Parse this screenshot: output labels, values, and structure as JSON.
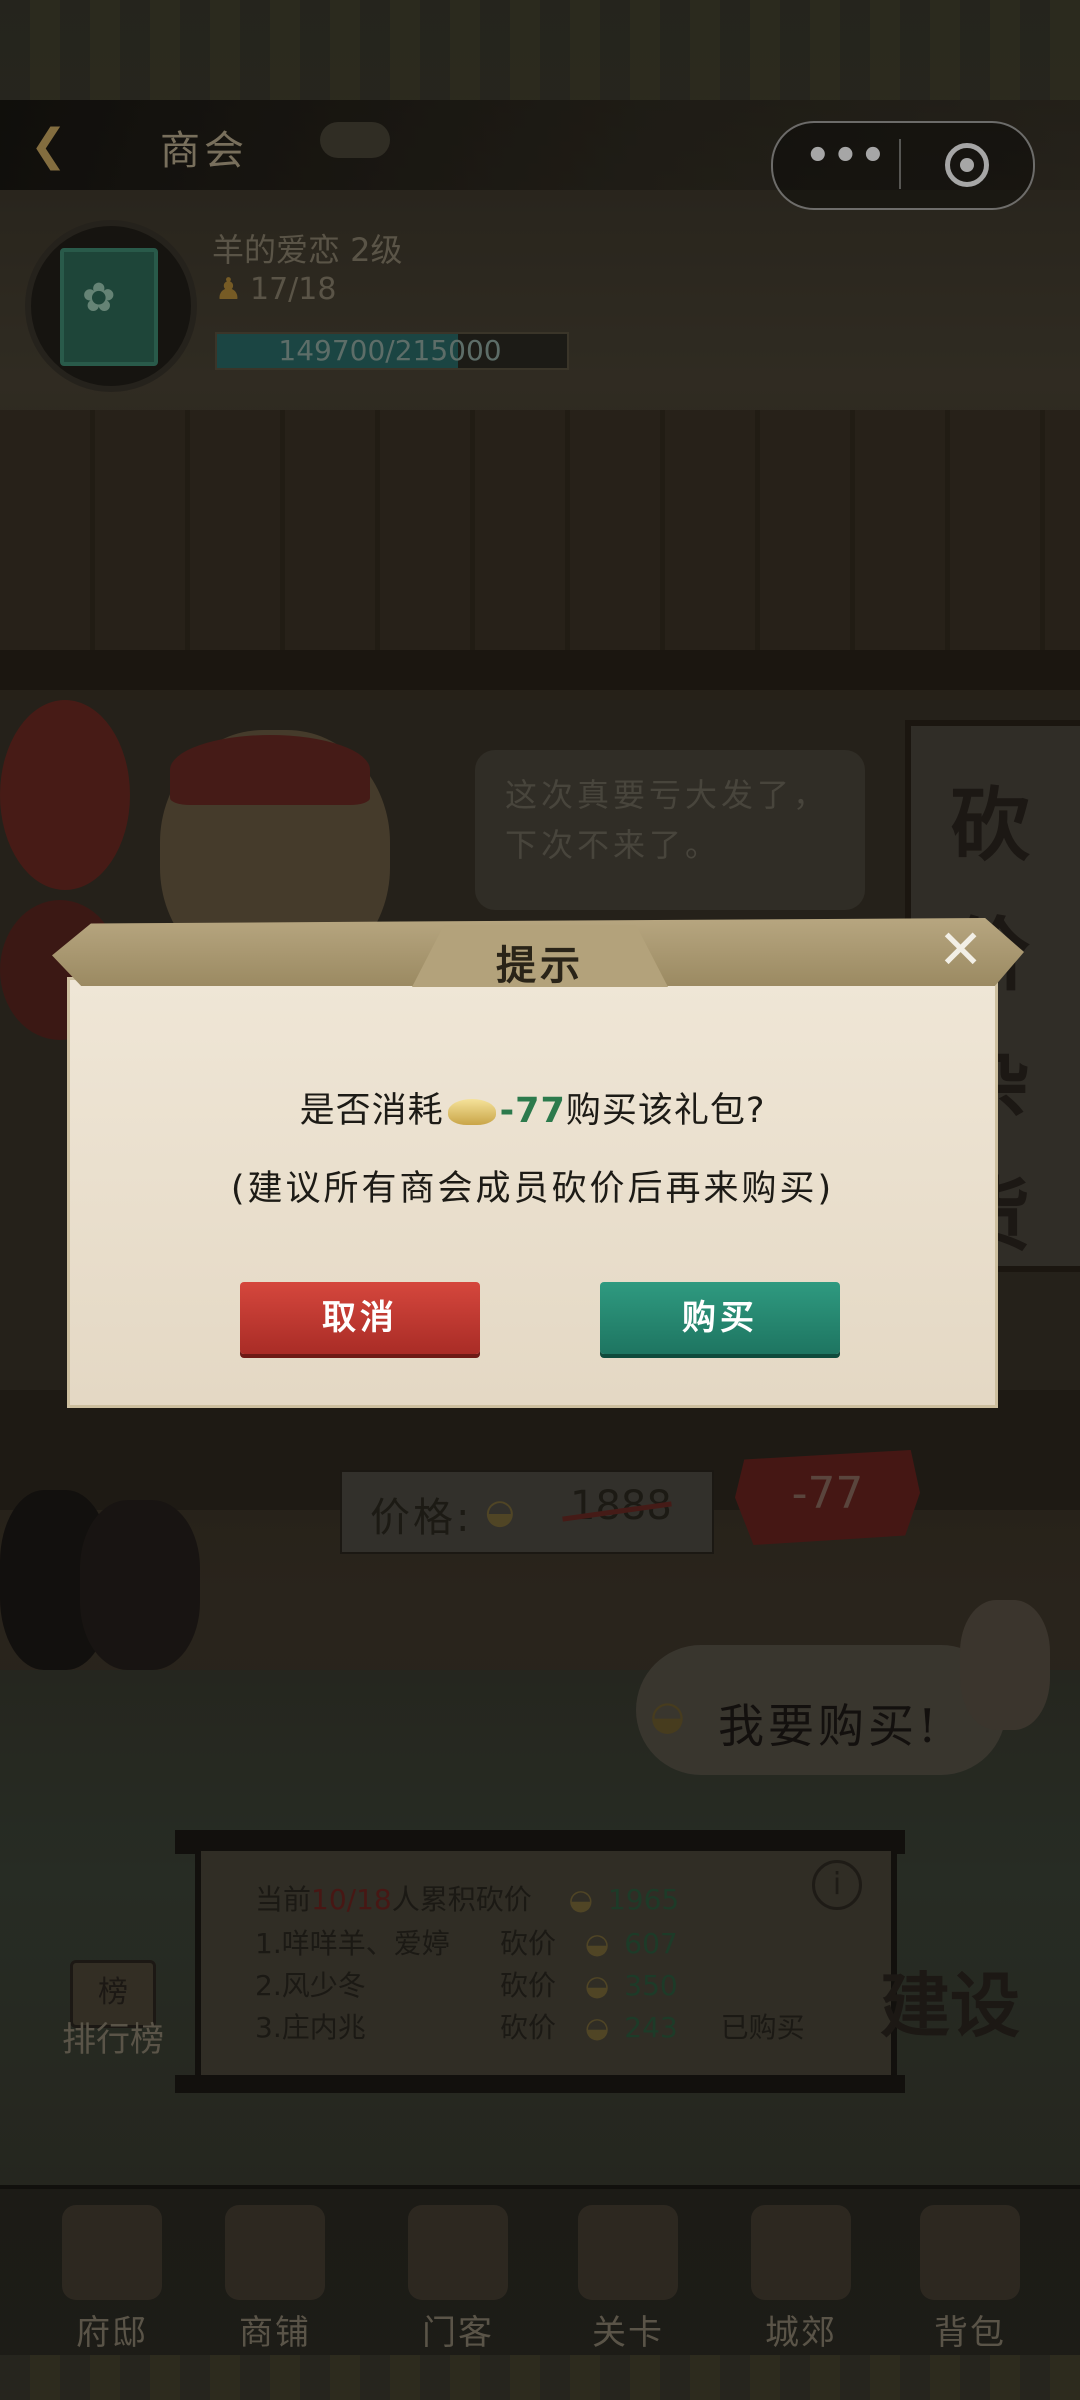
{
  "header": {
    "title": "商会"
  },
  "capsule": {
    "more": "•••"
  },
  "guild": {
    "name": "羊的爱恋 2级",
    "members": "17/18",
    "progress_text": "149700/215000",
    "progress_fraction": 0.696
  },
  "merchant": {
    "speech": "这次真要亏大发了，下次不来了。",
    "sign": "砍 价 杂 货"
  },
  "price": {
    "label": "价格:",
    "original": "1888",
    "cut": "-77"
  },
  "buy_bubble": {
    "text": "我要购买!"
  },
  "board": {
    "prefix": "当前",
    "count": "10/18",
    "suffix": "人累积砍价",
    "total": "1965",
    "info": "i",
    "rows": [
      {
        "name": "1.咩咩羊、爱婷",
        "action": "砍价",
        "amount": "607",
        "status": ""
      },
      {
        "name": "2.风少冬",
        "action": "砍价",
        "amount": "350",
        "status": ""
      },
      {
        "name": "3.庄内兆",
        "action": "砍价",
        "amount": "243",
        "status": "已购买"
      }
    ]
  },
  "side": {
    "rank_icon": "榜",
    "rank_label": "排行榜",
    "build_label": "建设"
  },
  "nav": [
    {
      "label": "府邸"
    },
    {
      "label": "商铺"
    },
    {
      "label": "门客"
    },
    {
      "label": "关卡"
    },
    {
      "label": "城郊"
    },
    {
      "label": "背包"
    }
  ],
  "dialog": {
    "title": "提示",
    "line1_prefix": "是否消耗",
    "line1_cost": "-77",
    "line1_suffix": "购买该礼包?",
    "line2": "(建议所有商会成员砍价后再来购买)",
    "cancel_label": "取消",
    "buy_label": "购买"
  },
  "colors": {
    "cancel": "#c23a32",
    "buy": "#25876f",
    "cost_green": "#2c7a4c"
  }
}
